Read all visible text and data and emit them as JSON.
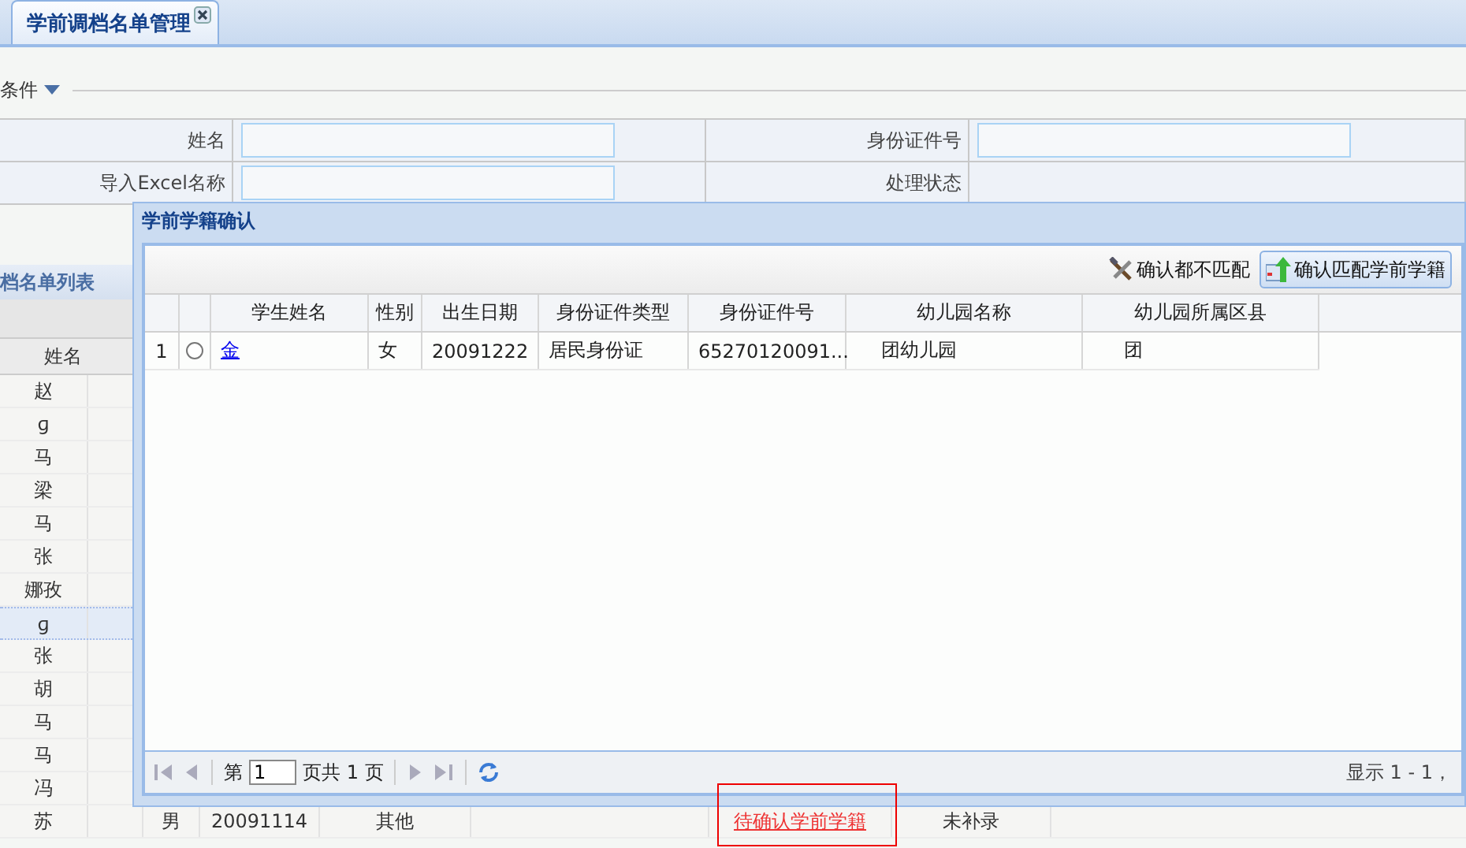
{
  "tab": {
    "title": "学前调档名单管理"
  },
  "search": {
    "title": "条件",
    "fields": [
      {
        "label": "姓名",
        "kind": "input"
      },
      {
        "label": "身份证件号",
        "kind": "input"
      },
      {
        "label": "导入Excel名称",
        "kind": "input"
      },
      {
        "label": "处理状态",
        "kind": "text"
      }
    ]
  },
  "list": {
    "title": "档名单列表",
    "column": "姓名",
    "rows": [
      {
        "name": "赵",
        "selected": false
      },
      {
        "name": "ɡ",
        "selected": false
      },
      {
        "name": "马",
        "selected": false
      },
      {
        "name": "梁",
        "selected": false
      },
      {
        "name": "马",
        "selected": false
      },
      {
        "name": "张",
        "selected": false
      },
      {
        "name": "娜孜",
        "selected": false
      },
      {
        "name": "ɡ",
        "selected": true
      },
      {
        "name": "张",
        "selected": false
      },
      {
        "name": "胡",
        "selected": false
      },
      {
        "name": "马",
        "selected": false
      },
      {
        "name": "马",
        "selected": false
      },
      {
        "name": "冯",
        "selected": false
      },
      {
        "name": "苏",
        "selected": false,
        "gender": "男",
        "birth": "20091114",
        "id_type": "其他",
        "status": "待确认学前学籍",
        "note": "未补录"
      }
    ]
  },
  "dialog": {
    "title": "学前学籍确认",
    "toolbar": [
      {
        "label": "确认都不匹配",
        "kind": "tools",
        "hovered": false
      },
      {
        "label": "确认匹配学前学籍",
        "kind": "upload",
        "hovered": true
      }
    ],
    "columns": [
      "学生姓名",
      "性别",
      "出生日期",
      "身份证件类型",
      "身份证件号",
      "幼儿园名称",
      "幼儿园所属区县"
    ],
    "rows": [
      {
        "index": "1",
        "selected": false,
        "cells": [
          "金",
          "女",
          "20091222",
          "居民身份证",
          "65270120091...",
          "团幼儿园",
          "团"
        ]
      }
    ],
    "pager": {
      "before": "第",
      "page": "1",
      "after": "页共 1 页",
      "summary": "显示 1 - 1，"
    }
  }
}
